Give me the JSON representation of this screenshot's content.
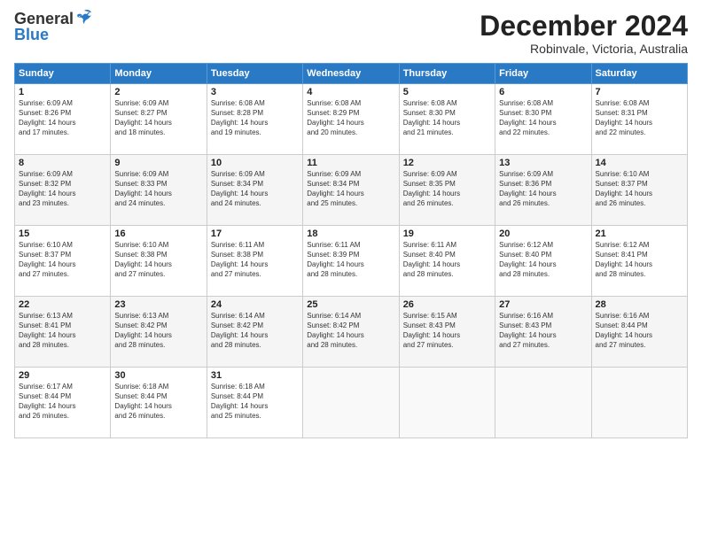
{
  "logo": {
    "general": "General",
    "blue": "Blue"
  },
  "header": {
    "month": "December 2024",
    "location": "Robinvale, Victoria, Australia"
  },
  "weekdays": [
    "Sunday",
    "Monday",
    "Tuesday",
    "Wednesday",
    "Thursday",
    "Friday",
    "Saturday"
  ],
  "weeks": [
    [
      {
        "day": "1",
        "info": "Sunrise: 6:09 AM\nSunset: 8:26 PM\nDaylight: 14 hours\nand 17 minutes."
      },
      {
        "day": "2",
        "info": "Sunrise: 6:09 AM\nSunset: 8:27 PM\nDaylight: 14 hours\nand 18 minutes."
      },
      {
        "day": "3",
        "info": "Sunrise: 6:08 AM\nSunset: 8:28 PM\nDaylight: 14 hours\nand 19 minutes."
      },
      {
        "day": "4",
        "info": "Sunrise: 6:08 AM\nSunset: 8:29 PM\nDaylight: 14 hours\nand 20 minutes."
      },
      {
        "day": "5",
        "info": "Sunrise: 6:08 AM\nSunset: 8:30 PM\nDaylight: 14 hours\nand 21 minutes."
      },
      {
        "day": "6",
        "info": "Sunrise: 6:08 AM\nSunset: 8:30 PM\nDaylight: 14 hours\nand 22 minutes."
      },
      {
        "day": "7",
        "info": "Sunrise: 6:08 AM\nSunset: 8:31 PM\nDaylight: 14 hours\nand 22 minutes."
      }
    ],
    [
      {
        "day": "8",
        "info": "Sunrise: 6:09 AM\nSunset: 8:32 PM\nDaylight: 14 hours\nand 23 minutes."
      },
      {
        "day": "9",
        "info": "Sunrise: 6:09 AM\nSunset: 8:33 PM\nDaylight: 14 hours\nand 24 minutes."
      },
      {
        "day": "10",
        "info": "Sunrise: 6:09 AM\nSunset: 8:34 PM\nDaylight: 14 hours\nand 24 minutes."
      },
      {
        "day": "11",
        "info": "Sunrise: 6:09 AM\nSunset: 8:34 PM\nDaylight: 14 hours\nand 25 minutes."
      },
      {
        "day": "12",
        "info": "Sunrise: 6:09 AM\nSunset: 8:35 PM\nDaylight: 14 hours\nand 26 minutes."
      },
      {
        "day": "13",
        "info": "Sunrise: 6:09 AM\nSunset: 8:36 PM\nDaylight: 14 hours\nand 26 minutes."
      },
      {
        "day": "14",
        "info": "Sunrise: 6:10 AM\nSunset: 8:37 PM\nDaylight: 14 hours\nand 26 minutes."
      }
    ],
    [
      {
        "day": "15",
        "info": "Sunrise: 6:10 AM\nSunset: 8:37 PM\nDaylight: 14 hours\nand 27 minutes."
      },
      {
        "day": "16",
        "info": "Sunrise: 6:10 AM\nSunset: 8:38 PM\nDaylight: 14 hours\nand 27 minutes."
      },
      {
        "day": "17",
        "info": "Sunrise: 6:11 AM\nSunset: 8:38 PM\nDaylight: 14 hours\nand 27 minutes."
      },
      {
        "day": "18",
        "info": "Sunrise: 6:11 AM\nSunset: 8:39 PM\nDaylight: 14 hours\nand 28 minutes."
      },
      {
        "day": "19",
        "info": "Sunrise: 6:11 AM\nSunset: 8:40 PM\nDaylight: 14 hours\nand 28 minutes."
      },
      {
        "day": "20",
        "info": "Sunrise: 6:12 AM\nSunset: 8:40 PM\nDaylight: 14 hours\nand 28 minutes."
      },
      {
        "day": "21",
        "info": "Sunrise: 6:12 AM\nSunset: 8:41 PM\nDaylight: 14 hours\nand 28 minutes."
      }
    ],
    [
      {
        "day": "22",
        "info": "Sunrise: 6:13 AM\nSunset: 8:41 PM\nDaylight: 14 hours\nand 28 minutes."
      },
      {
        "day": "23",
        "info": "Sunrise: 6:13 AM\nSunset: 8:42 PM\nDaylight: 14 hours\nand 28 minutes."
      },
      {
        "day": "24",
        "info": "Sunrise: 6:14 AM\nSunset: 8:42 PM\nDaylight: 14 hours\nand 28 minutes."
      },
      {
        "day": "25",
        "info": "Sunrise: 6:14 AM\nSunset: 8:42 PM\nDaylight: 14 hours\nand 28 minutes."
      },
      {
        "day": "26",
        "info": "Sunrise: 6:15 AM\nSunset: 8:43 PM\nDaylight: 14 hours\nand 27 minutes."
      },
      {
        "day": "27",
        "info": "Sunrise: 6:16 AM\nSunset: 8:43 PM\nDaylight: 14 hours\nand 27 minutes."
      },
      {
        "day": "28",
        "info": "Sunrise: 6:16 AM\nSunset: 8:44 PM\nDaylight: 14 hours\nand 27 minutes."
      }
    ],
    [
      {
        "day": "29",
        "info": "Sunrise: 6:17 AM\nSunset: 8:44 PM\nDaylight: 14 hours\nand 26 minutes."
      },
      {
        "day": "30",
        "info": "Sunrise: 6:18 AM\nSunset: 8:44 PM\nDaylight: 14 hours\nand 26 minutes."
      },
      {
        "day": "31",
        "info": "Sunrise: 6:18 AM\nSunset: 8:44 PM\nDaylight: 14 hours\nand 25 minutes."
      },
      {
        "day": "",
        "info": ""
      },
      {
        "day": "",
        "info": ""
      },
      {
        "day": "",
        "info": ""
      },
      {
        "day": "",
        "info": ""
      }
    ]
  ]
}
